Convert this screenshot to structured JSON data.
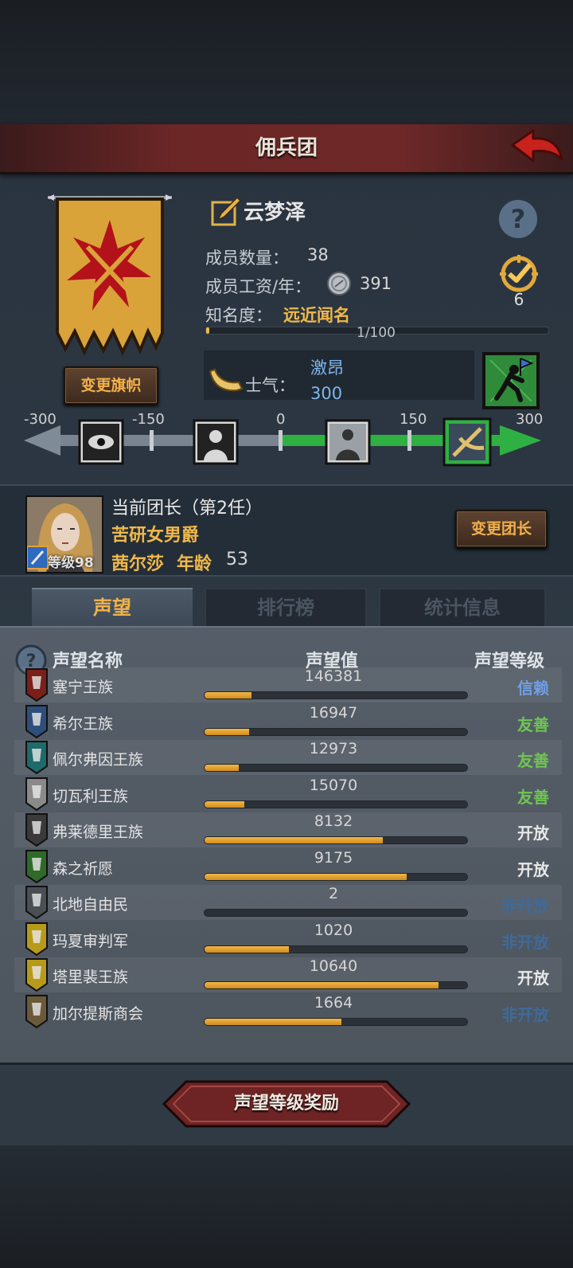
{
  "header": {
    "title": "佣兵团"
  },
  "guild": {
    "name": "云梦泽",
    "member_count_label": "成员数量：",
    "member_count": "38",
    "wage_label": "成员工资/年：",
    "wage_value": "391",
    "fame_label": "知名度：",
    "fame_value": "远近闻名",
    "fame_progress_text": "1/100",
    "fame_progress": 0.01,
    "change_flag_label": "变更旗帜",
    "target_count": "6"
  },
  "morale": {
    "label": "士气：",
    "name": "激昂",
    "value": "300",
    "scale_ticks": [
      "-300",
      "-150",
      "0",
      "150",
      "300"
    ]
  },
  "leader": {
    "title": "当前团长（第2任）",
    "rank": "苦研女男爵",
    "level_text": "等级98",
    "name": "茜尔莎",
    "age_label": "年龄",
    "age": "53",
    "change_label": "变更团长"
  },
  "tabs": [
    {
      "label": "声望"
    },
    {
      "label": "排行榜"
    },
    {
      "label": "统计信息"
    }
  ],
  "reputation": {
    "headers": {
      "name": "声望名称",
      "value": "声望值",
      "level": "声望等级"
    },
    "rows": [
      {
        "name": "塞宁王族",
        "value": "146381",
        "fill": 0.18,
        "level": "信赖",
        "level_color": "#6f9fe6",
        "icon": "serpent-crest-icon",
        "icon_bg": "#7a1f1a"
      },
      {
        "name": "希尔王族",
        "value": "16947",
        "fill": 0.17,
        "level": "友善",
        "level_color": "#6fc552",
        "icon": "helmet-crest-icon",
        "icon_bg": "#2e4f7a"
      },
      {
        "name": "佩尔弗因王族",
        "value": "12973",
        "fill": 0.13,
        "level": "友善",
        "level_color": "#6fc552",
        "icon": "wave-crest-icon",
        "icon_bg": "#1f6a6a"
      },
      {
        "name": "切瓦利王族",
        "value": "15070",
        "fill": 0.15,
        "level": "友善",
        "level_color": "#6fc552",
        "icon": "scales-crest-icon",
        "icon_bg": "#8a8a8a"
      },
      {
        "name": "弗莱德里王族",
        "value": "8132",
        "fill": 0.68,
        "level": "开放",
        "level_color": "#e8e8e8",
        "icon": "face-crest-icon",
        "icon_bg": "#3a3a3a"
      },
      {
        "name": "森之祈愿",
        "value": "9175",
        "fill": 0.77,
        "level": "开放",
        "level_color": "#e8e8e8",
        "icon": "tree-crest-icon",
        "icon_bg": "#2f6a2a"
      },
      {
        "name": "北地自由民",
        "value": "2",
        "fill": 0.0,
        "level": "非开放",
        "level_color": "#3f6a9a",
        "icon": "axe-crest-icon",
        "icon_bg": "#4a4f55"
      },
      {
        "name": "玛夏审判军",
        "value": "1020",
        "fill": 0.32,
        "level": "非开放",
        "level_color": "#3f6a9a",
        "icon": "chevron-crest-icon",
        "icon_bg": "#b89a1a"
      },
      {
        "name": "塔里裴王族",
        "value": "10640",
        "fill": 0.89,
        "level": "开放",
        "level_color": "#e8e8e8",
        "icon": "crown-crest-icon",
        "icon_bg": "#b89a1a"
      },
      {
        "name": "加尔提斯商会",
        "value": "1664",
        "fill": 0.52,
        "level": "非开放",
        "level_color": "#3f6a9a",
        "icon": "chest-crest-icon",
        "icon_bg": "#6a5a3a"
      }
    ]
  },
  "reward_button_label": "声望等级奖励",
  "colors": {
    "accent_gold": "#f0b84a",
    "title_red": "#6b2626",
    "morale_blue": "#7fb6ef"
  }
}
